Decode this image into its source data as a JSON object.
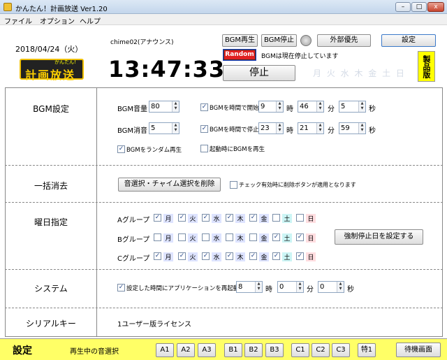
{
  "window": {
    "title": "かんたん！計画放送 Ver1.20",
    "min": "–",
    "max": "□",
    "close": "x"
  },
  "menu": [
    "ファイル",
    "オプション",
    "ヘルプ"
  ],
  "header": {
    "date": "2018/04/24（火）",
    "logo": "計画放送",
    "logo_small": "かんたん!",
    "chime": "chime02(アナウンス)",
    "time": "13:47:33",
    "bgm_play": "BGM再生",
    "bgm_stop": "BGM停止",
    "external": "外部優先",
    "settings": "設定",
    "random": "Random",
    "bgm_status": "BGMは現在停止しています",
    "stop": "停止",
    "weekdays": "月 火 水 木 金 土 日",
    "product": "製品版"
  },
  "bgm": {
    "section": "BGM設定",
    "volume_label": "BGM音量",
    "volume": "80",
    "mute_label": "BGM消音",
    "mute": "5",
    "start_label": "BGMを時間で開始",
    "start_h": "9",
    "start_m": "46",
    "start_s": "5",
    "stop_label": "BGMを時間で停止",
    "stop_h": "23",
    "stop_m": "21",
    "stop_s": "59",
    "hour": "時",
    "minute": "分",
    "second": "秒",
    "random_label": "BGMをランダム再生",
    "startup_label": "起動時にBGMを再生"
  },
  "clear": {
    "section": "一括消去",
    "button": "音選択・チャイム選択を削除",
    "check": "チェック有効時に削除ボタンが適用となります"
  },
  "days": {
    "section": "曜日指定",
    "labels": [
      "月",
      "火",
      "水",
      "木",
      "金",
      "土",
      "日"
    ],
    "groups": [
      {
        "name": "Aグループ",
        "checks": [
          true,
          true,
          true,
          true,
          true,
          false,
          false
        ]
      },
      {
        "name": "Bグループ",
        "checks": [
          false,
          false,
          false,
          false,
          false,
          true,
          true
        ]
      },
      {
        "name": "Cグループ",
        "checks": [
          true,
          true,
          true,
          true,
          true,
          true,
          true
        ]
      }
    ],
    "force_stop": "強制停止日を設定する"
  },
  "system": {
    "section": "システム",
    "restart": "設定した時間にアプリケーションを再起動する",
    "h": "8",
    "m": "0",
    "s": "0"
  },
  "serial": {
    "section": "シリアルキー",
    "value": "1ユーザー版ライセンス"
  },
  "status": {
    "title": "設定",
    "playing": "再生中の音選択",
    "buttons": [
      "A1",
      "A2",
      "A3",
      "B1",
      "B2",
      "B3",
      "C1",
      "C2",
      "C3",
      "特1"
    ],
    "standby": "待機画面"
  },
  "colors": {
    "day_bg": [
      "#dde3ff",
      "#dde3ff",
      "#dde3ff",
      "#dde3ff",
      "#dde3ff",
      "#ccf5f5",
      "#ffdde0"
    ]
  }
}
